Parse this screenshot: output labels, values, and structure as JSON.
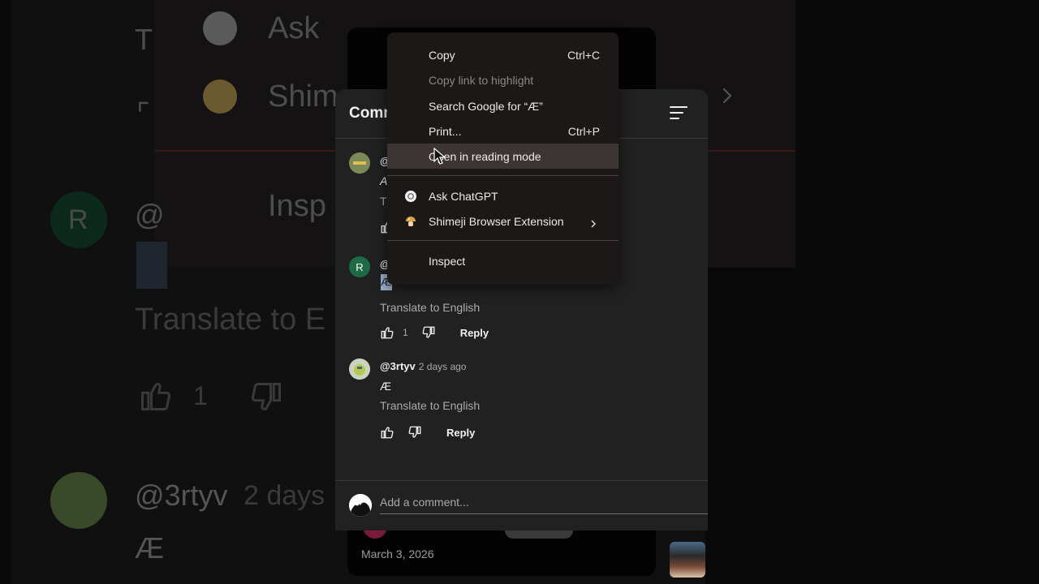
{
  "background": {
    "menu_items": {
      "ask": "Ask",
      "shimeji": "Shim",
      "inspect": "Insp",
      "partial_letter_t": "T"
    },
    "comment_r": {
      "avatar_letter": "R",
      "prefix": "@",
      "translate": "Translate to E",
      "like_count": "1"
    },
    "comment_3rtyv": {
      "author": "@3rtyv",
      "time": "2 days",
      "text": "Æ"
    }
  },
  "video_card": {
    "date": "March 3, 2026"
  },
  "comments_panel": {
    "title": "Comm",
    "comments": [
      {
        "author": "@",
        "time": "",
        "text": "A",
        "translate": "T",
        "like_count": ""
      },
      {
        "avatar_letter": "R",
        "author": "@",
        "time": "",
        "text": "Æ",
        "translate": "Translate to English",
        "like_count": "1",
        "reply": "Reply"
      },
      {
        "author": "@3rtyv",
        "time": "2 days ago",
        "text": "Æ",
        "translate": "Translate to English",
        "like_count": "",
        "reply": "Reply"
      }
    ],
    "add_comment_placeholder": "Add a comment..."
  },
  "context_menu": {
    "items": [
      {
        "label": "Copy",
        "shortcut": "Ctrl+C"
      },
      {
        "label": "Copy link to highlight",
        "shortcut": ""
      },
      {
        "label": "Search Google for “Æ”",
        "shortcut": ""
      },
      {
        "label": "Print...",
        "shortcut": "Ctrl+P"
      },
      {
        "label": "Open in reading mode",
        "shortcut": ""
      },
      {
        "label": "Ask ChatGPT",
        "shortcut": "",
        "icon": "chatgpt-icon"
      },
      {
        "label": "Shimeji Browser Extension",
        "shortcut": "",
        "icon": "shimeji-mushroom-icon",
        "submenu": true
      },
      {
        "label": "Inspect",
        "shortcut": ""
      }
    ]
  },
  "colors": {
    "panel_bg": "#212121",
    "menu_bg": "#1c1817",
    "menu_hover": "#3d3533",
    "avatar_r": "#1d6b44"
  }
}
